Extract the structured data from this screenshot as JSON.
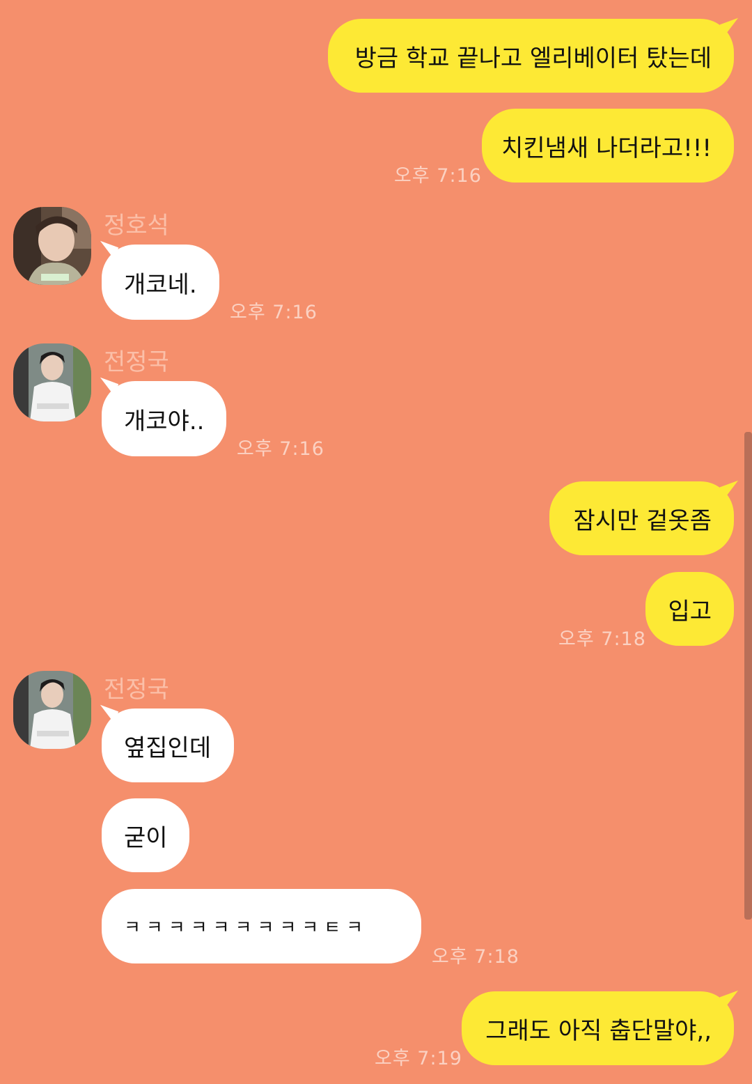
{
  "messages": {
    "m1": "방금 학교 끝나고 엘리베이터 탔는데",
    "m2": "치킨냄새 나더라고!!!",
    "t1": "오후 7:16",
    "s1": "정호석",
    "m3": "개코네.",
    "t2": "오후 7:16",
    "s2": "전정국",
    "m4": "개코야..",
    "t3": "오후 7:16",
    "m5": "잠시만 겉옷좀",
    "m6": "입고",
    "t4": "오후 7:18",
    "s3": "전정국",
    "m7": "옆집인데",
    "m8": "굳이",
    "m9": "ㅋㅋㅋㅋㅋㅋㅋㅋㅋㅌㅋ",
    "t5": "오후 7:18",
    "m10": "그래도 아직 춥단말야,,",
    "t6": "오후 7:19"
  },
  "colors": {
    "background": "#f58f6c",
    "mine_bubble": "#fde935",
    "their_bubble": "#ffffff"
  }
}
